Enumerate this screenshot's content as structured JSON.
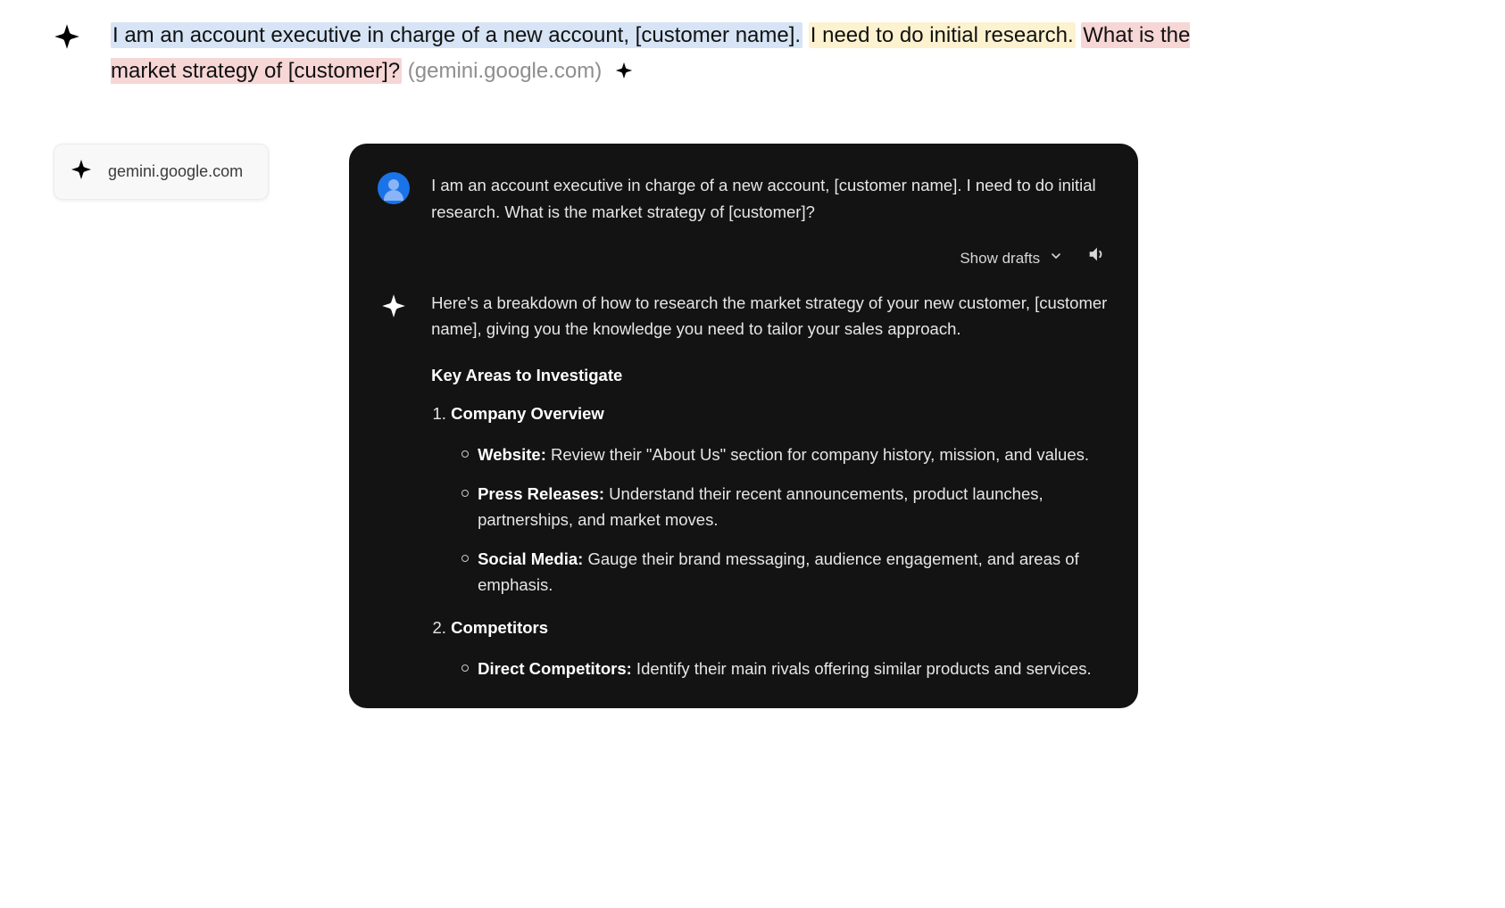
{
  "top": {
    "hl_blue": "I am an account executive in charge of a new account, [customer name].",
    "hl_yellow": "I need to do initial research.",
    "hl_pink": "What is  the market strategy of [customer]?",
    "source": "(gemini.google.com)"
  },
  "chip": {
    "label": "gemini.google.com"
  },
  "chat": {
    "user_message": "I am an account executive in charge of a new account, [customer name]. I need to do initial research. What is the market strategy of [customer]?",
    "tools": {
      "show_drafts": "Show drafts"
    },
    "response_intro": "Here's a breakdown of how to research the market strategy of your new customer, [customer name], giving you the knowledge you need to tailor your sales approach.",
    "section_heading": "Key Areas to Investigate",
    "items": [
      {
        "title": "Company Overview",
        "bullets": [
          {
            "label": "Website:",
            "text": " Review their \"About Us\" section for company history, mission, and values."
          },
          {
            "label": "Press Releases:",
            "text": " Understand their recent announcements, product launches, partnerships, and market moves."
          },
          {
            "label": "Social Media:",
            "text": " Gauge their brand messaging, audience engagement, and areas of emphasis."
          }
        ]
      },
      {
        "title": "Competitors",
        "bullets": [
          {
            "label": "Direct Competitors:",
            "text": " Identify their main rivals offering similar products and services."
          }
        ]
      }
    ]
  }
}
